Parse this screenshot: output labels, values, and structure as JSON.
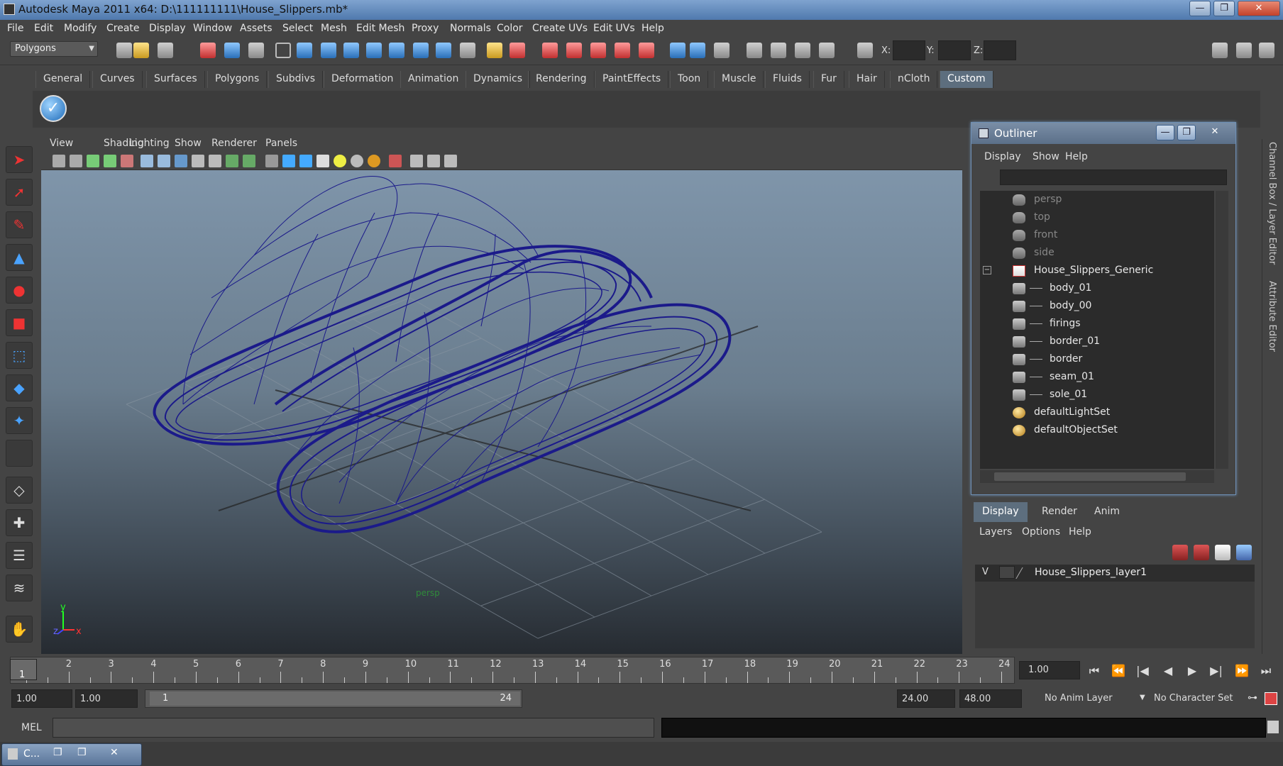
{
  "window": {
    "title": "Autodesk Maya 2011 x64: D:\\111111111\\House_Slippers.mb*",
    "minimize": "—",
    "maximize": "❐",
    "close": "✕"
  },
  "menubar": [
    "File",
    "Edit",
    "Modify",
    "Create",
    "Display",
    "Window",
    "Assets",
    "Select",
    "Mesh",
    "Edit Mesh",
    "Proxy",
    "Normals",
    "Color",
    "Create UVs",
    "Edit UVs",
    "Help"
  ],
  "statusline": {
    "mode": "Polygons",
    "x_label": "X:",
    "y_label": "Y:",
    "z_label": "Z:"
  },
  "shelf": {
    "tabs": [
      "General",
      "Curves",
      "Surfaces",
      "Polygons",
      "Subdivs",
      "Deformation",
      "Animation",
      "Dynamics",
      "Rendering",
      "PaintEffects",
      "Toon",
      "Muscle",
      "Fluids",
      "Fur",
      "Hair",
      "nCloth",
      "Custom"
    ],
    "active_tab": "Custom",
    "icon": "✓"
  },
  "viewport": {
    "menu": [
      "View",
      "Shading",
      "Lighting",
      "Show",
      "Renderer",
      "Panels"
    ],
    "camera_label": "persp",
    "axis_y": "y",
    "axis_z": "z",
    "axis_x": "x"
  },
  "outliner": {
    "title": "Outliner",
    "menu": [
      "Display",
      "Show",
      "Help"
    ],
    "items": [
      {
        "label": "persp",
        "type": "camera",
        "depth": 0,
        "dim": true
      },
      {
        "label": "top",
        "type": "camera",
        "depth": 0,
        "dim": true
      },
      {
        "label": "front",
        "type": "camera",
        "depth": 0,
        "dim": true
      },
      {
        "label": "side",
        "type": "camera",
        "depth": 0,
        "dim": true
      },
      {
        "label": "House_Slippers_Generic",
        "type": "group",
        "depth": 0,
        "dim": false,
        "expand": "−"
      },
      {
        "label": "body_01",
        "type": "mesh",
        "depth": 1,
        "dim": false
      },
      {
        "label": "body_00",
        "type": "mesh",
        "depth": 1,
        "dim": false
      },
      {
        "label": "firings",
        "type": "mesh",
        "depth": 1,
        "dim": false
      },
      {
        "label": "border_01",
        "type": "mesh",
        "depth": 1,
        "dim": false
      },
      {
        "label": "border",
        "type": "mesh",
        "depth": 1,
        "dim": false
      },
      {
        "label": "seam_01",
        "type": "mesh",
        "depth": 1,
        "dim": false
      },
      {
        "label": "sole_01",
        "type": "mesh",
        "depth": 1,
        "dim": false
      },
      {
        "label": "defaultLightSet",
        "type": "set",
        "depth": 0,
        "dim": false
      },
      {
        "label": "defaultObjectSet",
        "type": "set",
        "depth": 0,
        "dim": false
      }
    ]
  },
  "layers": {
    "tabs": [
      "Display",
      "Render",
      "Anim"
    ],
    "active_tab": "Display",
    "menu": [
      "Layers",
      "Options",
      "Help"
    ],
    "layer_visible": "V",
    "layer_name": "House_Slippers_layer1"
  },
  "right_strip": {
    "channel_box": "Channel Box / Layer Editor",
    "attribute_editor": "Attribute Editor"
  },
  "timeline": {
    "frames": [
      "1",
      "2",
      "3",
      "4",
      "5",
      "6",
      "7",
      "8",
      "9",
      "10",
      "11",
      "12",
      "13",
      "14",
      "15",
      "16",
      "17",
      "18",
      "19",
      "20",
      "21",
      "22",
      "23",
      "24"
    ],
    "current_frame": "1",
    "current_time": "1.00",
    "playback": [
      "⏮",
      "⏪",
      "|◀",
      "◀",
      "▶",
      "▶|",
      "⏩",
      "⏭"
    ]
  },
  "range": {
    "start": "1.00",
    "playback_start": "1.00",
    "slider_start": "1",
    "slider_end": "24",
    "playback_end": "24.00",
    "end": "48.00",
    "anim_layer": "No Anim Layer",
    "character_set": "No Character Set"
  },
  "command": {
    "label": "MEL"
  },
  "taskbar": {
    "item": "C..."
  },
  "colors": {
    "wireframe": "#1b1a8a",
    "active_tab": "#5d6e7e",
    "title_bar": "#5b7fb0"
  }
}
